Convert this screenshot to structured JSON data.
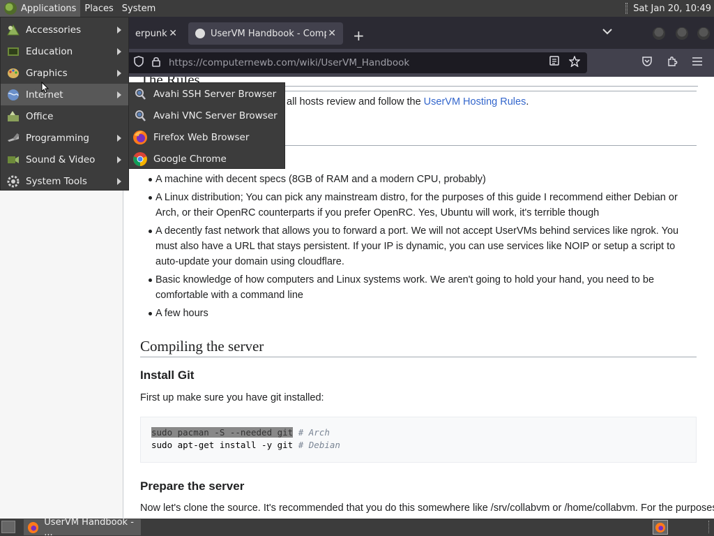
{
  "top_panel": {
    "applications": "Applications",
    "places": "Places",
    "system": "System",
    "clock": "Sat Jan 20, 10:49"
  },
  "browser": {
    "tabs": [
      {
        "label": "erpunk W",
        "close": "✕"
      },
      {
        "label": "UserVM Handbook - Compu",
        "close": "✕"
      }
    ],
    "new_tab": "+",
    "url_host": "https://computernewb.com",
    "url_path": "/wiki/UserVM_Handbook"
  },
  "page": {
    "rules_heading": "The Rules",
    "rules_text": "all hosts review and follow the ",
    "rules_link": "UserVM Hosting Rules",
    "rules_end": ".",
    "requirements": [
      "A machine with decent specs (8GB of RAM and a modern CPU, probably)",
      "A Linux distribution; You can pick any mainstream distro, for the purposes of this guide I recommend either Debian or Arch, or their OpenRC counterparts if you prefer OpenRC. Yes, Ubuntu will work, it's terrible though",
      "A decently fast network that allows you to forward a port. We will not accept UserVMs behind services like ngrok. You must also have a URL that stays persistent. If your IP is dynamic, you can use services like NOIP or setup a script to auto-update your domain using cloudflare.",
      "Basic knowledge of how computers and Linux systems work. We aren't going to hold your hand, you need to be comfortable with a command line",
      "A few hours"
    ],
    "compile_heading": "Compiling the server",
    "git_heading": "Install Git",
    "git_text": "First up make sure you have git installed:",
    "code_line1_cmd": "sudo pacman -S --needed git",
    "code_line1_comment": "# Arch",
    "code_line2_cmd": "sudo apt-get install -y git",
    "code_line2_comment": "# Debian",
    "prep_heading": "Prepare the server",
    "prep_text": "Now let's clone the source. It's recommended that you do this somewhere like /srv/collabvm or /home/collabvm. For the purposes"
  },
  "apps_menu": {
    "items": [
      {
        "label": "Accessories",
        "icon": "accessories-icon"
      },
      {
        "label": "Education",
        "icon": "education-icon"
      },
      {
        "label": "Graphics",
        "icon": "graphics-icon"
      },
      {
        "label": "Internet",
        "icon": "internet-icon"
      },
      {
        "label": "Office",
        "icon": "office-icon"
      },
      {
        "label": "Programming",
        "icon": "programming-icon"
      },
      {
        "label": "Sound & Video",
        "icon": "sound-video-icon"
      },
      {
        "label": "System Tools",
        "icon": "system-tools-icon"
      }
    ],
    "active": "Internet"
  },
  "internet_submenu": {
    "items": [
      {
        "label": "Avahi SSH Server Browser",
        "icon": "avahi-ssh-icon"
      },
      {
        "label": "Avahi VNC Server Browser",
        "icon": "avahi-vnc-icon"
      },
      {
        "label": "Firefox Web Browser",
        "icon": "firefox-icon"
      },
      {
        "label": "Google Chrome",
        "icon": "chrome-icon"
      }
    ]
  },
  "taskbar": {
    "firefox_task": "UserVM Handbook - ..."
  },
  "colors": {
    "panel": "#3c3c3c",
    "link": "#3366cc",
    "firefox_toolbar": "#42414d"
  }
}
